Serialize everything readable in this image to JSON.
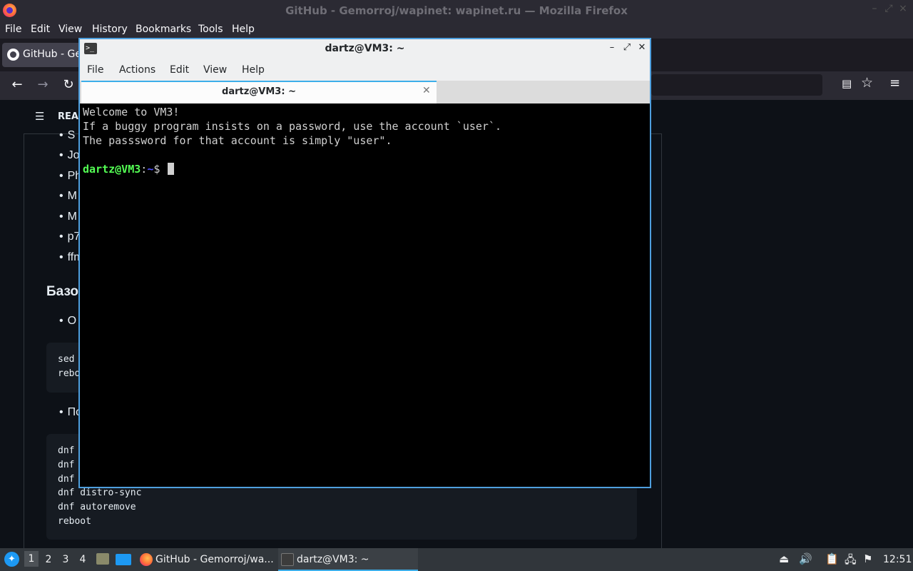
{
  "firefox": {
    "window_title": "GitHub - Gemorroj/wapinet: wapinet.ru — Mozilla Firefox",
    "menu": [
      {
        "label": "File"
      },
      {
        "label": "Edit"
      },
      {
        "label": "View"
      },
      {
        "label": "History"
      },
      {
        "label": "Bookmarks"
      },
      {
        "label": "Tools"
      },
      {
        "label": "Help"
      }
    ],
    "tab_label": "GitHub - Gemorroj/wapinet: wapinet.ru",
    "icons": {
      "back": "←",
      "forward": "→",
      "reload": "↻",
      "reader": "▤",
      "bookmark": "☆",
      "menu": "≡"
    }
  },
  "page": {
    "readme_label": "README",
    "bullets": [
      "S",
      "Jo",
      "Ph",
      "M",
      "M",
      "p7",
      "ffm"
    ],
    "section_heading": "Базо",
    "bullet_after_heading": "О",
    "code_block_1": [
      "sed",
      "rebo"
    ],
    "bullet_after_code": "По",
    "code_block_2": [
      "dnf",
      "dnf",
      "dnf",
      "dnf distro-sync",
      "dnf autoremove",
      "reboot"
    ]
  },
  "terminal": {
    "title": "dartz@VM3: ~",
    "menu": [
      "File",
      "Actions",
      "Edit",
      "View",
      "Help"
    ],
    "tab_label": "dartz@VM3: ~",
    "lines": [
      "Welcome to VM3!",
      "If a buggy program insists on a password, use the account `user`.",
      "The passsword for that account is simply \"user\"."
    ],
    "prompt_user": "dartz@VM3",
    "prompt_colon": ":",
    "prompt_dir": "~",
    "prompt_symbol": "$ "
  },
  "taskbar": {
    "desktops": [
      "1",
      "2",
      "3",
      "4"
    ],
    "tasks": [
      {
        "label": "GitHub - Gemorroj/wa..."
      },
      {
        "label": "dartz@VM3: ~"
      }
    ],
    "clock": "12:51"
  }
}
